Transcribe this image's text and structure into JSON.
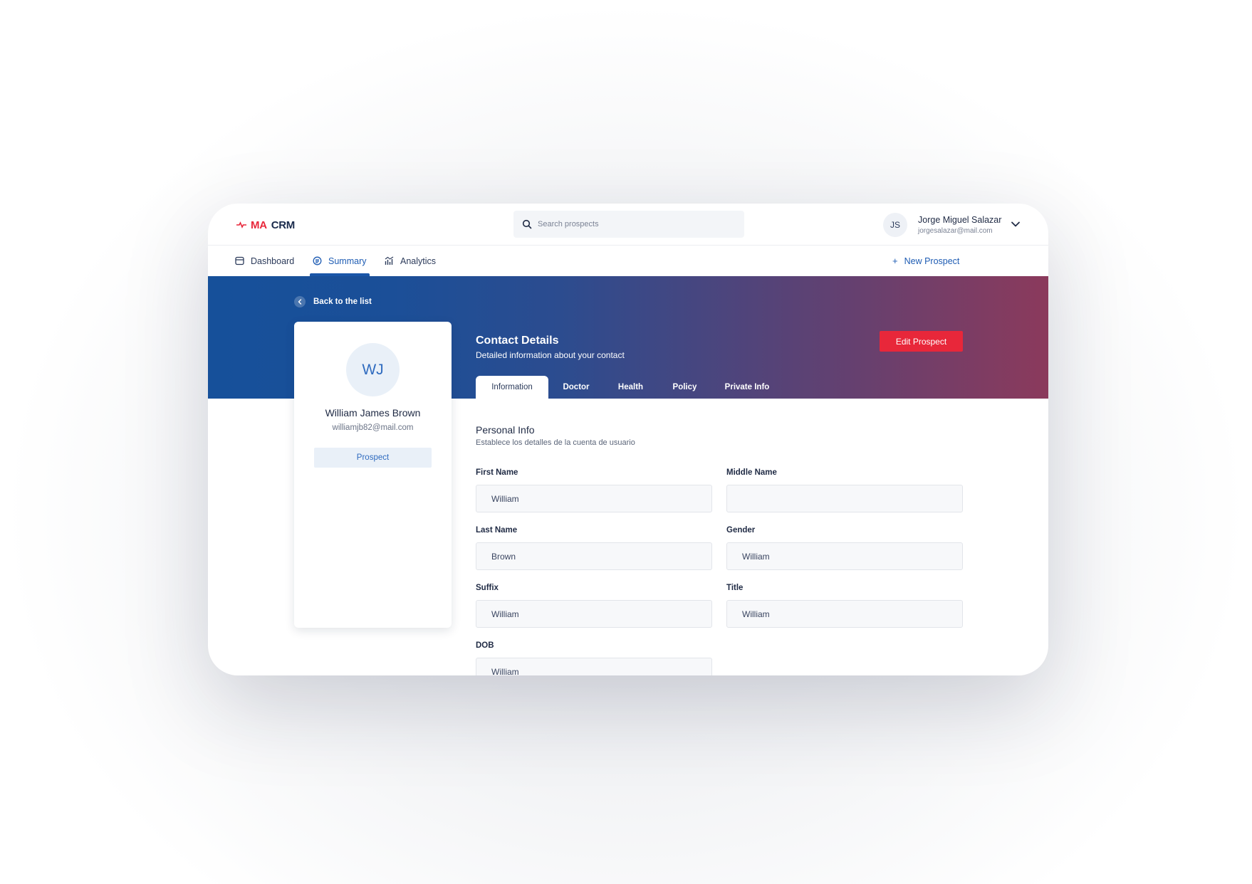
{
  "brand": {
    "ma": "MA",
    "crm": "CRM"
  },
  "search": {
    "placeholder": "Search prospects"
  },
  "user": {
    "initials": "JS",
    "name": "Jorge Miguel Salazar",
    "email": "jorgesalazar@mail.com"
  },
  "nav": {
    "items": [
      {
        "label": "Dashboard",
        "icon": "dashboard-icon"
      },
      {
        "label": "Summary",
        "icon": "summary-icon",
        "active": true
      },
      {
        "label": "Analytics",
        "icon": "analytics-icon"
      }
    ],
    "new_prospect": "New Prospect"
  },
  "back": {
    "label": "Back to the list"
  },
  "contact": {
    "title": "Contact Details",
    "subtitle": "Detailed information about your contact",
    "edit_label": "Edit Prospect"
  },
  "tabs": [
    {
      "label": "Information",
      "active": true
    },
    {
      "label": "Doctor"
    },
    {
      "label": "Health"
    },
    {
      "label": "Policy"
    },
    {
      "label": "Private Info"
    }
  ],
  "profile": {
    "initials": "WJ",
    "name": "William James Brown",
    "email": "williamjb82@mail.com",
    "badge": "Prospect"
  },
  "form": {
    "section_title": "Personal Info",
    "section_subtitle": "Establece los detalles de la cuenta de usuario",
    "fields": {
      "first_name": {
        "label": "First Name",
        "value": "William"
      },
      "middle_name": {
        "label": "Middle Name",
        "value": ""
      },
      "last_name": {
        "label": "Last Name",
        "value": "Brown"
      },
      "gender": {
        "label": "Gender",
        "value": "William"
      },
      "suffix": {
        "label": "Suffix",
        "value": "William"
      },
      "title": {
        "label": "Title",
        "value": "William"
      },
      "dob": {
        "label": "DOB",
        "value": "William"
      }
    }
  },
  "colors": {
    "accent": "#1e5cb3",
    "brand_red": "#e8273a",
    "banner_start": "#16509a",
    "banner_end": "#8b3a5c"
  }
}
